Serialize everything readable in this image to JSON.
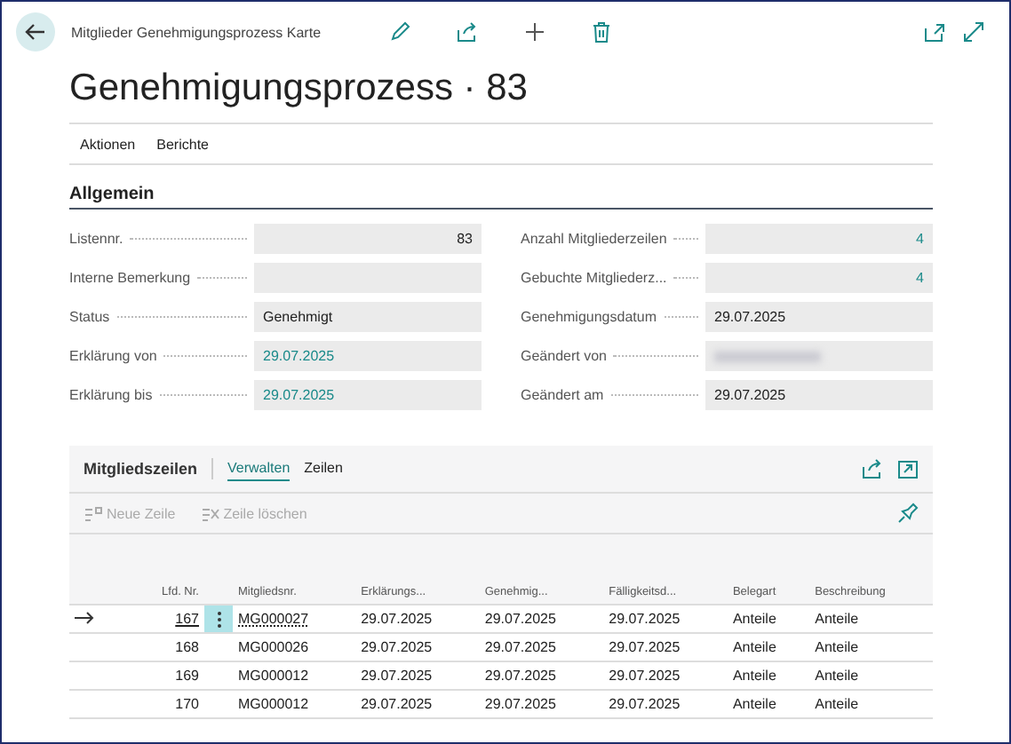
{
  "page": {
    "caption": "Mitglieder Genehmigungsprozess Karte",
    "title": "Genehmigungsprozess · 83"
  },
  "action_bar": [
    "Aktionen",
    "Berichte"
  ],
  "section": {
    "title": "Allgemein",
    "left_fields": [
      {
        "label": "Listennr.",
        "value": "83",
        "kind": "number"
      },
      {
        "label": "Interne Bemerkung",
        "kind": "text"
      },
      {
        "label": "Status",
        "value": "Genehmigt",
        "kind": "text"
      },
      {
        "label": "Erklärung von",
        "value": "29.07.2025",
        "kind": "link"
      },
      {
        "label": "Erklärung bis",
        "value": "29.07.2025",
        "kind": "link"
      }
    ],
    "right_fields": [
      {
        "label": "Anzahl Mitgliederzeilen",
        "value": "4",
        "kind": "number-link"
      },
      {
        "label": "Gebuchte Mitgliederz...",
        "value": "4",
        "kind": "number-link"
      },
      {
        "label": "Genehmigungsdatum",
        "value": "29.07.2025",
        "kind": "text"
      },
      {
        "label": "Geändert von",
        "kind": "blurred"
      },
      {
        "label": "Geändert am",
        "value": "29.07.2025",
        "kind": "text"
      }
    ]
  },
  "lines": {
    "title": "Mitgliedszeilen",
    "tabs": [
      {
        "label": "Verwalten",
        "selected": true
      },
      {
        "label": "Zeilen",
        "selected": false
      }
    ],
    "toolbar": [
      {
        "label": "Neue Zeile",
        "disabled": true
      },
      {
        "label": "Zeile löschen",
        "disabled": true
      }
    ],
    "columns": [
      "Lfd. Nr.",
      "Mitgliedsnr.",
      "Erklärungs...",
      "Genehmig...",
      "Fälligkeitsd...",
      "Belegart",
      "Beschreibung"
    ],
    "rows": [
      {
        "selected": true,
        "cells": [
          "167",
          "MG000027",
          "29.07.2025",
          "29.07.2025",
          "29.07.2025",
          "Anteile",
          "Anteile"
        ]
      },
      {
        "selected": false,
        "cells": [
          "168",
          "MG000026",
          "29.07.2025",
          "29.07.2025",
          "29.07.2025",
          "Anteile",
          "Anteile"
        ]
      },
      {
        "selected": false,
        "cells": [
          "169",
          "MG000012",
          "29.07.2025",
          "29.07.2025",
          "29.07.2025",
          "Anteile",
          "Anteile"
        ]
      },
      {
        "selected": false,
        "cells": [
          "170",
          "MG000012",
          "29.07.2025",
          "29.07.2025",
          "29.07.2025",
          "Anteile",
          "Anteile"
        ]
      }
    ]
  }
}
